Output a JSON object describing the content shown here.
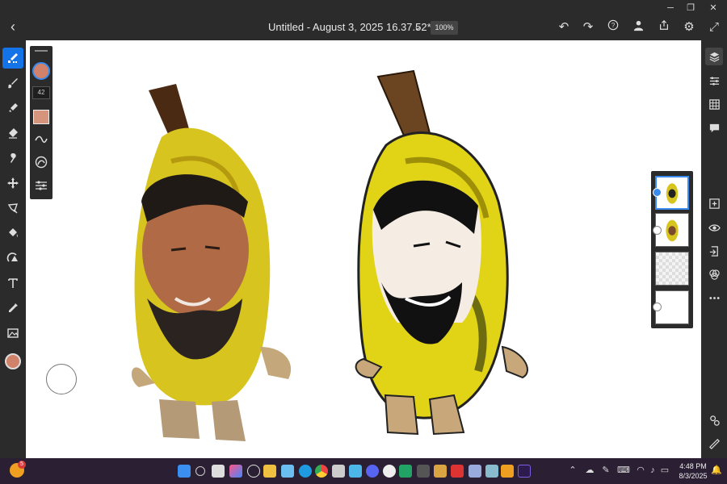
{
  "window": {
    "minimize": "─",
    "restore": "❐",
    "close": "✕"
  },
  "header": {
    "back_icon": "back-arrow-icon",
    "title": "Untitled - August 3, 2025 16.37.52*",
    "title_chevron": "chevron-down-icon",
    "zoom": "100%",
    "actions": [
      "undo-icon",
      "redo-icon",
      "help-icon",
      "user-icon",
      "share-icon",
      "settings-icon",
      "expand-icon"
    ]
  },
  "left_toolbar": {
    "tools": [
      "pixel-brush",
      "live-brush",
      "vector-brush",
      "eraser",
      "smudge",
      "transform",
      "selection",
      "fill",
      "shape",
      "text",
      "eyedropper",
      "image"
    ],
    "active_tool": "pixel-brush",
    "color": "#d2826a"
  },
  "brush_panel": {
    "size": "42",
    "brush_color": "#d2826a",
    "opacity_color": "#d4957c"
  },
  "canvas": {
    "background": "#ffffff"
  },
  "right_toolbar": {
    "tools": [
      "layers",
      "layer-properties",
      "adjustments",
      "comments",
      "add-layer",
      "visibility",
      "import",
      "blend-mode",
      "more"
    ],
    "bottom_tools": [
      "shapes",
      "ruler"
    ]
  },
  "layers_panel": {
    "layers": [
      {
        "name": "layer-1",
        "selected": true,
        "badge": "blue"
      },
      {
        "name": "layer-2",
        "selected": false,
        "badge": "white"
      },
      {
        "name": "layer-3",
        "selected": false,
        "badge": null
      },
      {
        "name": "layer-4",
        "selected": false,
        "badge": "white"
      }
    ]
  },
  "taskbar": {
    "weather_badge": "5",
    "clock_time": "4:48 PM",
    "clock_date": "8/3/2025",
    "apps": [
      "windows-start",
      "search",
      "copilot",
      "widgets",
      "chat",
      "file-explorer",
      "edge",
      "chrome",
      "screen-capture",
      "notepad",
      "discord",
      "app-store",
      "excel",
      "paint",
      "vpn",
      "photos",
      "calendar",
      "fresco"
    ]
  }
}
